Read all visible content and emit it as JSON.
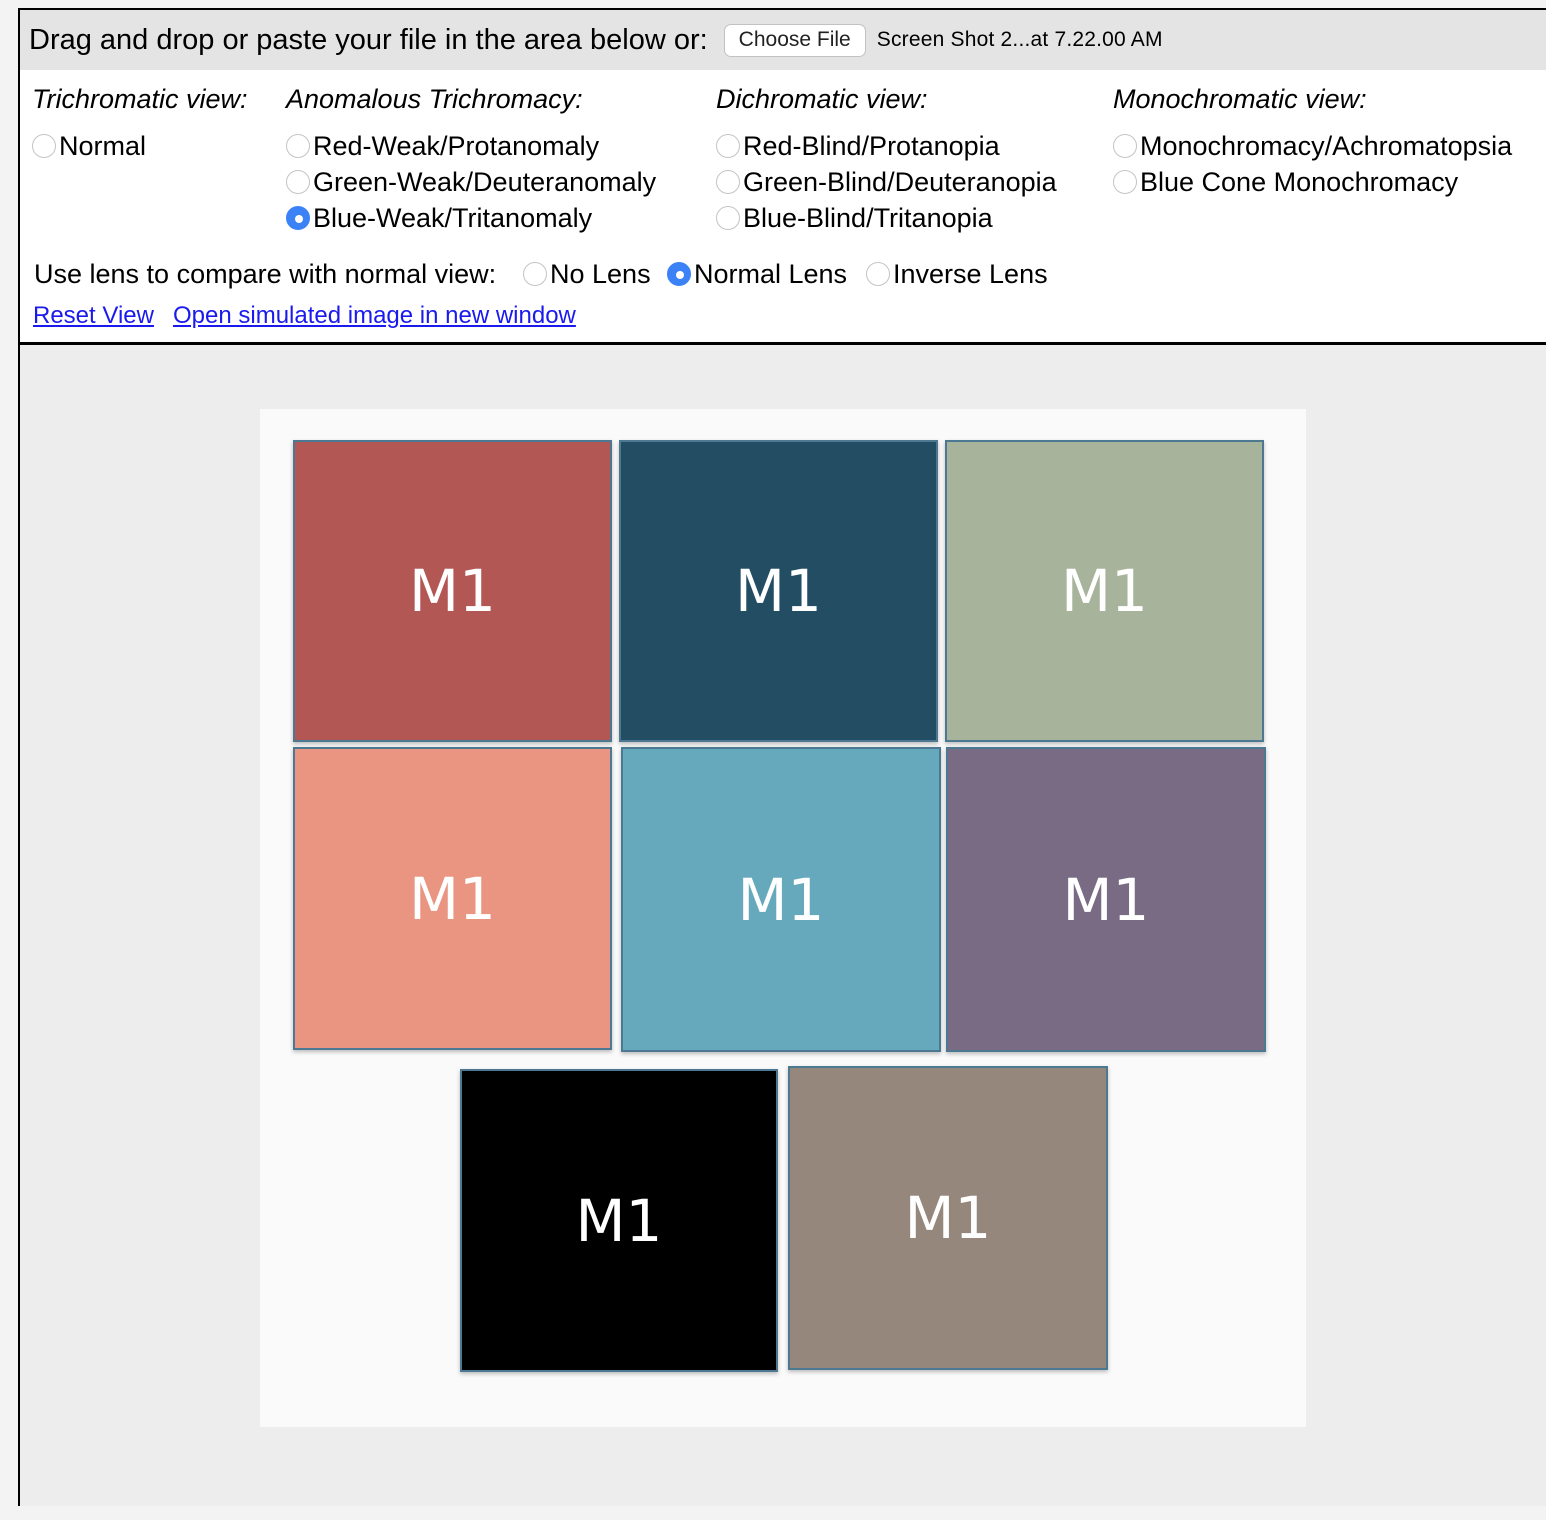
{
  "topbar": {
    "drop_label": "Drag and drop or paste your file in the area below or:",
    "choose_file_label": "Choose File",
    "file_name": "Screen Shot 2...at 7.22.00 AM"
  },
  "groups": {
    "trichromatic": {
      "title": "Trichromatic view:",
      "options": [
        {
          "label": "Normal",
          "checked": false
        }
      ]
    },
    "anomalous": {
      "title": "Anomalous Trichromacy:",
      "options": [
        {
          "label": "Red-Weak/Protanomaly",
          "checked": false
        },
        {
          "label": "Green-Weak/Deuteranomaly",
          "checked": false
        },
        {
          "label": "Blue-Weak/Tritanomaly",
          "checked": true
        }
      ]
    },
    "dichromatic": {
      "title": "Dichromatic view:",
      "options": [
        {
          "label": "Red-Blind/Protanopia",
          "checked": false
        },
        {
          "label": "Green-Blind/Deuteranopia",
          "checked": false
        },
        {
          "label": "Blue-Blind/Tritanopia",
          "checked": false
        }
      ]
    },
    "monochromatic": {
      "title": "Monochromatic view:",
      "options": [
        {
          "label": "Monochromacy/Achromatopsia",
          "checked": false
        },
        {
          "label": "Blue Cone Monochromacy",
          "checked": false
        }
      ]
    }
  },
  "lens": {
    "label": "Use lens to compare with normal view:",
    "options": [
      {
        "label": "No Lens",
        "checked": false
      },
      {
        "label": "Normal Lens",
        "checked": true
      },
      {
        "label": "Inverse Lens",
        "checked": false
      }
    ]
  },
  "links": {
    "reset_view": "Reset View",
    "open_window": "Open simulated image in new window"
  },
  "tiles": [
    {
      "label": "M1",
      "color": "#b25753"
    },
    {
      "label": "M1",
      "color": "#234d62"
    },
    {
      "label": "M1",
      "color": "#a7b39b"
    },
    {
      "label": "M1",
      "color": "#e99581"
    },
    {
      "label": "M1",
      "color": "#66a9bc"
    },
    {
      "label": "M1",
      "color": "#796b83"
    },
    {
      "label": "M1",
      "color": "#000000"
    },
    {
      "label": "M1",
      "color": "#96877c"
    }
  ]
}
